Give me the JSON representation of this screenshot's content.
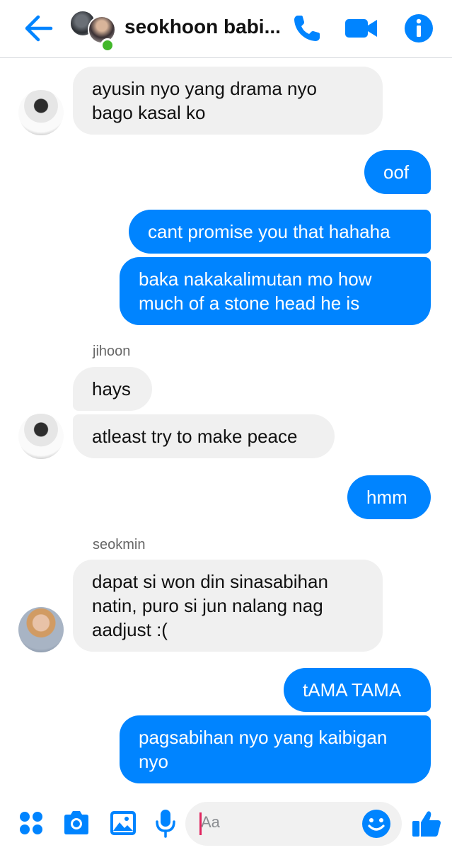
{
  "header": {
    "title": "seokhoon babi...",
    "colors": {
      "accent": "#0084ff",
      "online": "#42b72a"
    }
  },
  "messages": [
    {
      "dir": "in",
      "text": "ayusin nyo yang drama nyo\nbago kasal ko"
    },
    {
      "dir": "out",
      "text": "oof"
    },
    {
      "dir": "out",
      "text": "cant promise you that hahaha"
    },
    {
      "dir": "out",
      "text": "baka nakakalimutan mo how\nmuch of a stone head he is"
    },
    {
      "dir": "in",
      "sender": "jihoon",
      "text": "hays"
    },
    {
      "dir": "in",
      "text": "atleast try to make peace"
    },
    {
      "dir": "out",
      "text": "hmm"
    },
    {
      "dir": "in",
      "sender": "seokmin",
      "text": "dapat si won din sinasabihan\nnatin, puro si jun nalang nag\naadjust :("
    },
    {
      "dir": "out",
      "text": "tAMA TAMA"
    },
    {
      "dir": "out",
      "text": "pagsabihan nyo yang kaibigan\nnyo"
    }
  ],
  "composer": {
    "placeholder": "Aa"
  }
}
